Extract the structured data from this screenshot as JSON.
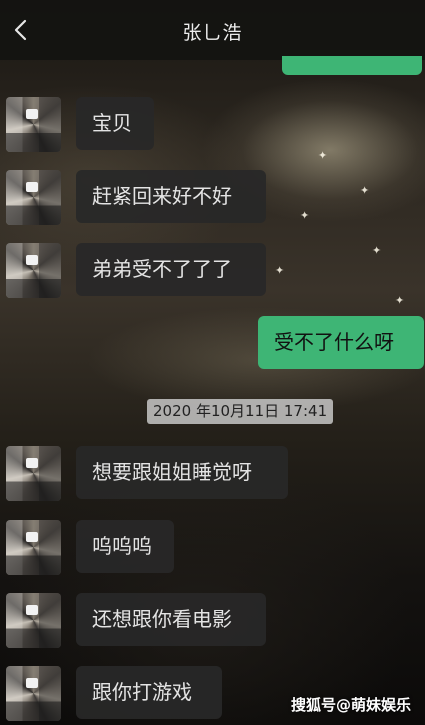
{
  "header": {
    "title": "张乚浩",
    "back_icon": "chevron-left-icon"
  },
  "messages": [
    {
      "direction": "incoming",
      "text": "宝贝"
    },
    {
      "direction": "incoming",
      "text": "赶紧回来好不好"
    },
    {
      "direction": "incoming",
      "text": "弟弟受不了了了"
    },
    {
      "direction": "outgoing",
      "text": "受不了什么呀"
    },
    {
      "direction": "incoming",
      "text": "想要跟姐姐睡觉呀"
    },
    {
      "direction": "incoming",
      "text": "呜呜呜"
    },
    {
      "direction": "incoming",
      "text": "还想跟你看电影"
    },
    {
      "direction": "incoming",
      "text": "跟你打游戏"
    }
  ],
  "timestamp": "2020 年10月11日 17:41",
  "watermark": "搜狐号@萌妹娱乐",
  "colors": {
    "outgoing_bubble": "#3eb575",
    "incoming_bubble": "#282828",
    "header_bg": "#141311"
  }
}
